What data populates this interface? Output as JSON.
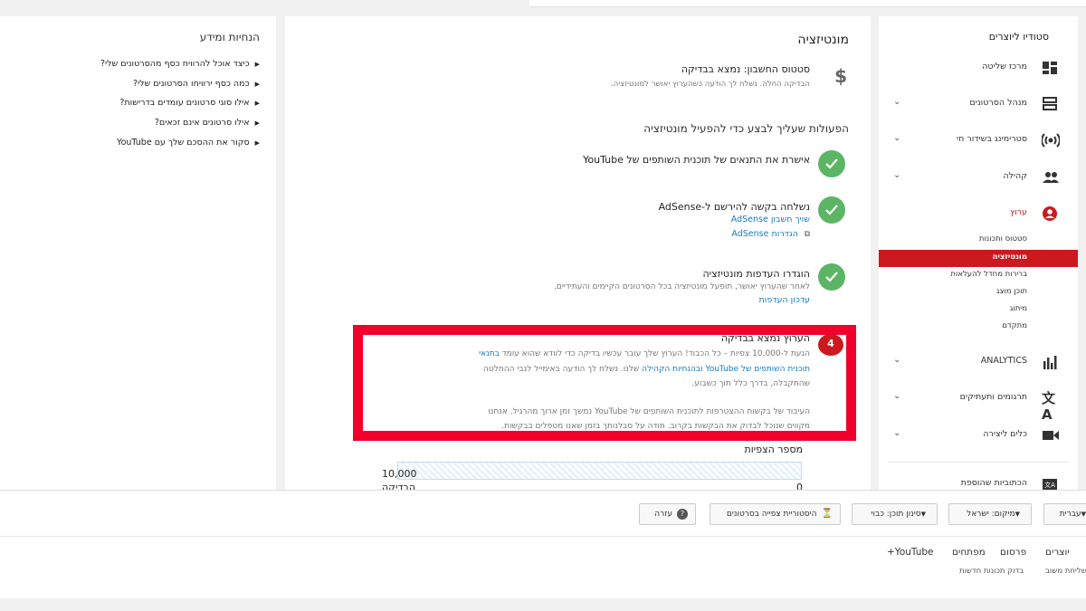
{
  "sidebar": {
    "title": "סטודיו ליוצרים",
    "items": [
      {
        "label": "מרכז שליטה",
        "icon": "dashboard-icon"
      },
      {
        "label": "מנהל הסרטונים",
        "icon": "video-manager-icon"
      },
      {
        "label": "סטרימינג בשידור חי",
        "icon": "live-stream-icon"
      },
      {
        "label": "קהילה",
        "icon": "community-icon"
      },
      {
        "label": "ערוץ",
        "icon": "channel-icon"
      }
    ],
    "channel_sub": [
      "סטטוס ותכונות",
      "מונטיזציה",
      "ברירות מחדל להעלאות",
      "תוכן מוצג",
      "מיתוג",
      "מתקדם"
    ],
    "items2": [
      {
        "label": "ANALYTICS",
        "icon": "analytics-icon"
      },
      {
        "label": "תרגומים ותעתיקים",
        "icon": "translate-icon"
      },
      {
        "label": "כלים ליצירה",
        "icon": "create-icon"
      },
      {
        "label": "הכתוביות שהוספת",
        "icon": "subtitles-icon"
      }
    ]
  },
  "main": {
    "title": "מונטיזציה",
    "status_title": "סטטוס החשבון: נמצא בבדיקה",
    "status_sub": "הבדיקה החלה. נשלח לך הודעה כשהערוץ יאושר למונטיזציה.",
    "steps_heading": "הפעולות שעליך לבצע כדי להפעיל מונטיזציה",
    "step1_title": "אישרת את התנאים של תוכנית השותפים של YouTube",
    "step2_title": "נשלחה בקשה להירשם ל-AdSense",
    "step2_link1": "שויך חשבון AdSense",
    "step2_link2": "הגדרות AdSense",
    "step3_title": "הוגדרו העדפות מונטיזציה",
    "step3_sub": "לאחר שהערוץ יאושר, תופעל מונטיזציה בכל הסרטונים הקיימים והעתידיים.",
    "step3_link": "עדכון העדפות",
    "step4_number": "4",
    "step4_title": "הערוץ נמצא בבדיקה",
    "step4_line1": "הגעת ל-10,000 צפיות – כל הכבוד! הערוץ שלך עובר עכשיו בדיקה כדי לוודא שהוא עומד",
    "step4_link_a": "בתנאי",
    "step4_link_b": "תוכנית השותפים של YouTube ובהנחיות הקהילה",
    "step4_line2_rest": "שלנו. נשלח לך הודעה באימייל לגבי ההחלטה",
    "step4_line3": "שהתקבלה, בדרך כלל תוך כשבוע.",
    "step4_line4": "העיבוד של בקשות ההצטרפות לתוכנית השותפים של YouTube נמשך זמן ארוך מהרגיל. אנחנו",
    "step4_line5": "מקווים שנוכל לבדוק את הבקשות בקרוב. תודה על סבלנותך בזמן שאנו מטפלים בבקשות.",
    "views_label": "מספר הצפיות",
    "views_max": "10,000",
    "views_min": "0",
    "views_status": "הבדיקה",
    "views_progress": 1.0
  },
  "info": {
    "title": "הנחיות ומידע",
    "links": [
      "כיצד אוכל להרוויח כסף מהסרטונים שלי?",
      "כמה כסף ירוויחו הסרטונים שלי?",
      "אילו סוגי סרטונים עומדים בדרישות?",
      "אילו סרטונים אינם זכאים?",
      "סקור את ההסכם שלך עם YouTube"
    ]
  },
  "footer": {
    "lang_btn": "עברית",
    "location_btn": "מיקום: ישראל",
    "filter_btn": "סינון תוכן: כבוי",
    "history_btn": "היסטוריית צפייה בסרטונים",
    "help_btn": "עזרה",
    "links": [
      "יוצרים",
      "פרסום",
      "מפתחים",
      "+YouTube"
    ],
    "small_links": [
      "שליחת משוב",
      "בדוק תכונות חדשות"
    ]
  },
  "colors": {
    "accent": "#cc181e",
    "link": "#167ac6",
    "check": "#5cb565",
    "highlight": "#f0002a"
  }
}
